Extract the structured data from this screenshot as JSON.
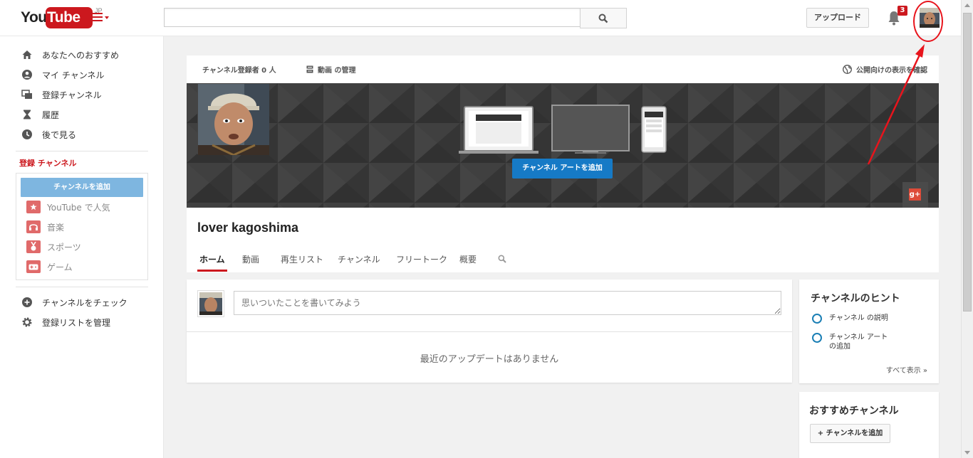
{
  "header": {
    "logo_you": "You",
    "logo_tube": "Tube",
    "logo_region": "JP",
    "search_placeholder": "",
    "upload_label": "アップロード",
    "notification_count": "3"
  },
  "sidebar": {
    "nav": [
      {
        "label": "あなたへのおすすめ",
        "icon": "home-icon"
      },
      {
        "label": "マイ チャンネル",
        "icon": "person-icon"
      },
      {
        "label": "登録チャンネル",
        "icon": "subscriptions-icon"
      },
      {
        "label": "履歴",
        "icon": "hourglass-icon"
      },
      {
        "label": "後で見る",
        "icon": "clock-icon"
      }
    ],
    "subscriptions_heading": "登録 チャンネル",
    "add_channel_label": "チャンネルを追加",
    "subscriptions": [
      {
        "label": "YouTube で人気",
        "icon": "star-icon",
        "color": "#e06a6a"
      },
      {
        "label": "音楽",
        "icon": "headphones-icon",
        "color": "#e06a6a"
      },
      {
        "label": "スポーツ",
        "icon": "medal-icon",
        "color": "#e06a6a"
      },
      {
        "label": "ゲーム",
        "icon": "gamepad-icon",
        "color": "#e06a6a"
      }
    ],
    "bottom": [
      {
        "label": "チャンネルをチェック",
        "icon": "plus-circle-icon"
      },
      {
        "label": "登録リストを管理",
        "icon": "gear-icon"
      }
    ]
  },
  "channel": {
    "subscriber_count": "チャンネル登録者 0 人",
    "manage_videos": "動画 の管理",
    "public_view": "公開向けの表示を確認",
    "add_art_label": "チャンネル アートを追加",
    "name": "lover kagoshima",
    "tabs": [
      "ホーム",
      "動画",
      "再生リスト",
      "チャンネル",
      "フリートーク",
      "概要"
    ],
    "active_tab": "ホーム"
  },
  "feed": {
    "post_placeholder": "思いついたことを書いてみよう",
    "empty_message": "最近のアップデートはありません"
  },
  "hints": {
    "title": "チャンネルのヒント",
    "items": [
      "チャンネル の説明",
      "チャンネル アート",
      "の追加"
    ],
    "see_all": "すべて表示 »"
  },
  "recommended": {
    "title": "おすすめチャンネル",
    "button_label": "+ チャンネルを追加"
  },
  "colors": {
    "brand_red": "#cc181e",
    "accent_blue": "#167ac6",
    "annotation_red": "#e8141c"
  }
}
